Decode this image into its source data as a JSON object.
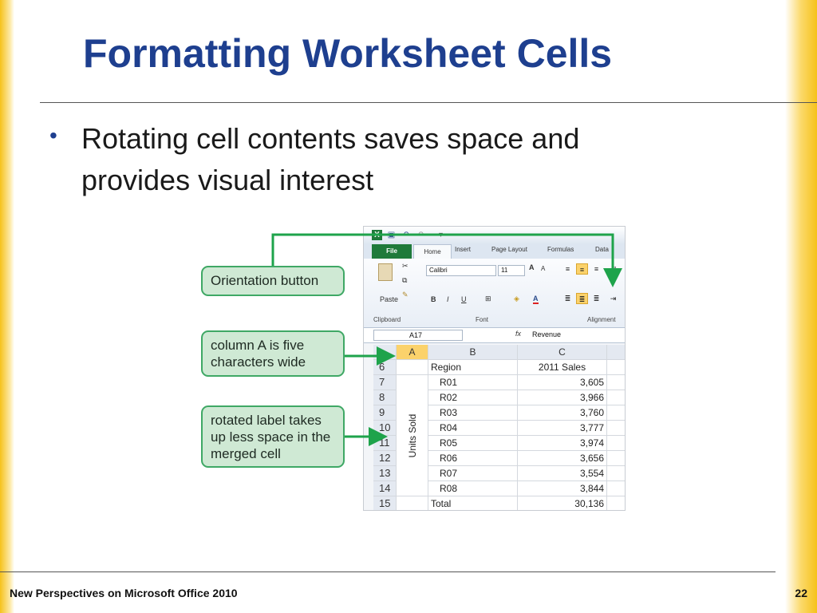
{
  "slide": {
    "title": "Formatting Worksheet Cells",
    "bullet_text": "Rotating cell contents saves space and provides visual interest",
    "footer": "New Perspectives on Microsoft Office 2010",
    "page_number": "22"
  },
  "callouts": {
    "orientation": "Orientation button",
    "column_a": "column A is five characters wide",
    "rotated": "rotated label takes up less space in the merged cell"
  },
  "excel": {
    "tabs": [
      "File",
      "Home",
      "Insert",
      "Page Layout",
      "Formulas",
      "Data"
    ],
    "clipboard": {
      "paste": "Paste",
      "label": "Clipboard"
    },
    "font_group": {
      "font_name": "Calibri",
      "font_size": "11",
      "label": "Font",
      "bold": "B",
      "italic": "I",
      "underline": "U"
    },
    "alignment_label": "Alignment",
    "name_box": "A17",
    "fx": "fx",
    "formula_value": "Revenue",
    "col_headers": [
      "A",
      "B",
      "C"
    ],
    "rotated_label": "Units Sold",
    "rows": [
      {
        "n": "6",
        "b": "Region",
        "c": "2011 Sales"
      },
      {
        "n": "7",
        "b": "R01",
        "c": "3,605"
      },
      {
        "n": "8",
        "b": "R02",
        "c": "3,966"
      },
      {
        "n": "9",
        "b": "R03",
        "c": "3,760"
      },
      {
        "n": "10",
        "b": "R04",
        "c": "3,777"
      },
      {
        "n": "11",
        "b": "R05",
        "c": "3,974"
      },
      {
        "n": "12",
        "b": "R06",
        "c": "3,656"
      },
      {
        "n": "13",
        "b": "R07",
        "c": "3,554"
      },
      {
        "n": "14",
        "b": "R08",
        "c": "3,844"
      },
      {
        "n": "15",
        "b": "Total",
        "c": "30,136"
      }
    ]
  },
  "colors": {
    "title": "#1e3f8f",
    "callout_fill": "#cfe9d4",
    "callout_border": "#3fa865",
    "arrow": "#1ea34b",
    "file_tab": "#1f7a3a"
  }
}
